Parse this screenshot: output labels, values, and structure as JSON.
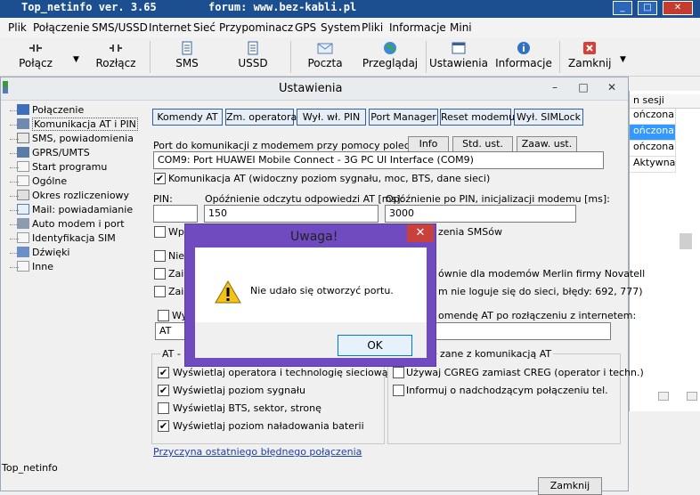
{
  "main_window": {
    "title": "Top_netinfo ver. 3.65",
    "forum": "forum: www.bez-kabli.pl",
    "minimize": "_",
    "maximize": "□",
    "close": "✕"
  },
  "menu": [
    "Plik",
    "Połączenie",
    "SMS/USSD",
    "Internet",
    "Sieć",
    "Przypominacz",
    "GPS",
    "System",
    "Pliki",
    "Informacje",
    "Mini"
  ],
  "toolbar": {
    "connect": "Połącz",
    "disconnect": "Rozłącz",
    "sms": "SMS",
    "ussd": "USSD",
    "mail": "Poczta",
    "browse": "Przeglądaj",
    "settings": "Ustawienia",
    "info": "Informacje",
    "close": "Zamknij"
  },
  "bg_panel": {
    "header": "n sesji",
    "rows": [
      "ończona",
      "ończona",
      "ończona",
      "Aktywna"
    ]
  },
  "settings": {
    "title": "Ustawienia",
    "tree": [
      "Połączenie",
      "Komunikacja AT i PIN",
      "SMS, powiadomienia",
      "GPRS/UMTS",
      "Start programu",
      "Ogólne",
      "Okres rozliczeniowy",
      "Mail: powiadamianie",
      "Auto modem i port",
      "Identyfikacja SIM",
      "Dźwięki",
      "Inne"
    ],
    "tabs": [
      "Komendy AT",
      "Zm. operatora",
      "Wył. wł. PIN",
      "Port Manager",
      "Reset modemu",
      "Wył. SIMLock"
    ],
    "port_label": "Port do komunikacji z modemem przy pomocy poleceń AT:",
    "btn_info": "Info",
    "btn_std": "Std. ust.",
    "btn_adv": "Zaaw. ust.",
    "port_value": "COM9: Port HUAWEI Mobile Connect - 3G PC UI Interface (COM9)",
    "chk_at": "Komunikacja AT (widoczny poziom sygnału, moc, BTS, dane sieci)",
    "pin_label": "PIN:",
    "delay_label": "Opóźnienie odczytu odpowiedzi AT [ms]:",
    "delay_value": "150",
    "pin_delay_label": "Opóźnienie po PIN, inicjalizacji modemu [ms]:",
    "pin_delay_value": "3000",
    "frag_wpr": "Wpr",
    "frag_sms": "zenia SMSów",
    "frag_nie": "Nie",
    "frag_zai1": "Zai",
    "frag_merlin": "ównie dla modemów Merlin firmy Novatell",
    "frag_zai2": "Zai",
    "frag_errors": "m nie loguje się do sieci, błędy: 692, 777)",
    "frag_wy": "Wy",
    "frag_cmd": "omendę AT po rozłączeniu z internetem:",
    "at_value": "AT",
    "grp_at": "AT - o",
    "grp_related": "zane z komunikacją AT",
    "opt_tech": "Wyświetlaj operatora i technologię sieciową",
    "opt_signal": "Wyświetlaj poziom sygnału",
    "opt_bts": "Wyświetlaj BTS, sektor, stronę",
    "opt_battery": "Wyświetlaj poziom naładowania baterii",
    "opt_cgreg": "Używaj CGREG zamiast CREG (operator i techn.)",
    "opt_incoming": "Informuj o nadchodzącym połączeniu tel.",
    "error_link": "Przyczyna ostatniego błędnego połączenia",
    "close_btn": "Zamknij"
  },
  "status": {
    "text": "Top_netinfo"
  },
  "modal": {
    "title": "Uwaga!",
    "message": "Nie udało się otworzyć portu.",
    "ok": "OK",
    "close": "✕"
  }
}
